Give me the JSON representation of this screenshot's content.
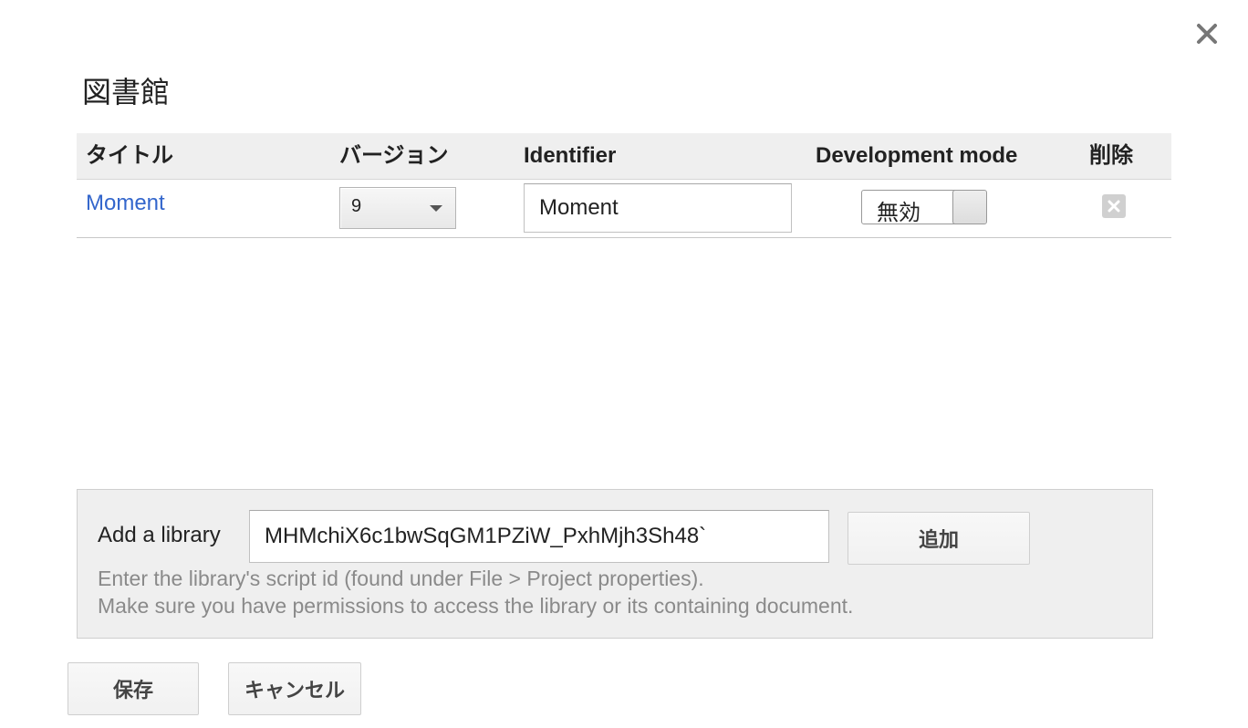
{
  "dialog": {
    "title": "図書館",
    "close_icon": "close-icon"
  },
  "table": {
    "headers": {
      "title": "タイトル",
      "version": "バージョン",
      "identifier": "Identifier",
      "dev_mode": "Development mode",
      "delete": "削除"
    },
    "rows": [
      {
        "title": "Moment",
        "version": "9",
        "identifier": "Moment",
        "dev_mode": "無効",
        "delete_icon": "delete-x-icon"
      }
    ]
  },
  "add_library": {
    "label": "Add a library",
    "script_id_value": "MHMchiX6c1bwSqGM1PZiW_PxhMjh3Sh48`",
    "add_button": "追加",
    "help_line_1": "Enter the library's script id (found under File > Project properties).",
    "help_line_2": "Make sure you have permissions to access the library or its containing document."
  },
  "footer": {
    "save_button": "保存",
    "cancel_button": "キャンセル"
  },
  "colors": {
    "link": "#3366cc",
    "header_bg": "#efefef",
    "panel_bg": "#efefef",
    "help_text": "#8a8a8a"
  }
}
